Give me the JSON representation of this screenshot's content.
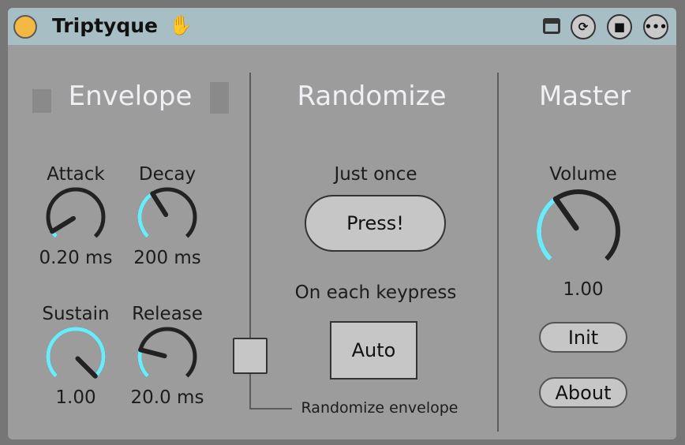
{
  "device": {
    "title": "Triptyque",
    "icons": [
      "power-button",
      "hand-icon",
      "calendar-icon",
      "sync-icon",
      "save-icon",
      "more-icon"
    ]
  },
  "envelope": {
    "header": "Envelope",
    "knobs": [
      {
        "label": "Attack",
        "value": "0.20 ms",
        "fraction": 0.05
      },
      {
        "label": "Decay",
        "value": "200 ms",
        "fraction": 0.38
      },
      {
        "label": "Sustain",
        "value": "1.00",
        "fraction": 1.0
      },
      {
        "label": "Release",
        "value": "20.0 ms",
        "fraction": 0.22
      }
    ]
  },
  "randomize": {
    "header": "Randomize",
    "just_once": "Just once",
    "press_label": "Press!",
    "on_each": "On each keypress",
    "auto_label": "Auto",
    "envelope_toggle_label": "Randomize envelope"
  },
  "master": {
    "header": "Master",
    "volume": {
      "label": "Volume",
      "value": "1.00",
      "fraction": 0.37
    },
    "init_label": "Init",
    "about_label": "About"
  },
  "colors": {
    "accent": "#6deaf8",
    "knob": "#222222"
  }
}
